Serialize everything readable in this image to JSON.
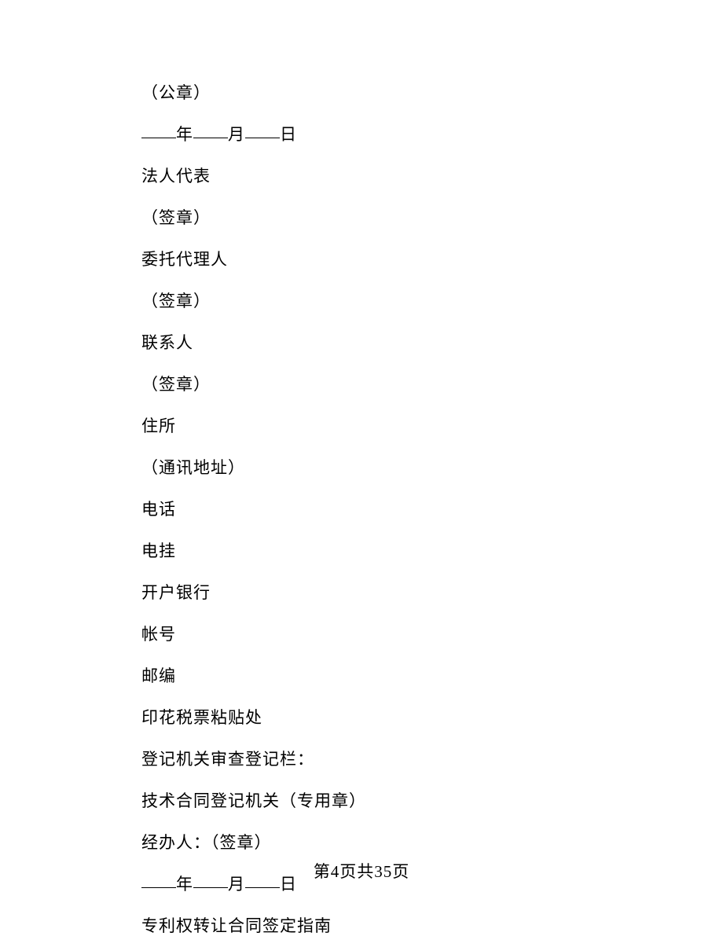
{
  "lines": [
    {
      "type": "text",
      "value": "（公章）"
    },
    {
      "type": "date",
      "parts": [
        "年",
        "月",
        "日"
      ]
    },
    {
      "type": "text",
      "value": "法人代表"
    },
    {
      "type": "text",
      "value": "（签章）"
    },
    {
      "type": "text",
      "value": "委托代理人"
    },
    {
      "type": "text",
      "value": "（签章）"
    },
    {
      "type": "text",
      "value": "联系人"
    },
    {
      "type": "text",
      "value": "（签章）"
    },
    {
      "type": "text",
      "value": "住所"
    },
    {
      "type": "text",
      "value": "（通讯地址）"
    },
    {
      "type": "text",
      "value": "电话"
    },
    {
      "type": "text",
      "value": "电挂"
    },
    {
      "type": "text",
      "value": "开户银行"
    },
    {
      "type": "text",
      "value": "帐号"
    },
    {
      "type": "text",
      "value": "邮编"
    },
    {
      "type": "text",
      "value": "印花税票粘贴处"
    },
    {
      "type": "text",
      "value": "登记机关审查登记栏："
    },
    {
      "type": "text",
      "value": "技术合同登记机关（专用章）"
    },
    {
      "type": "text",
      "value": "经办人：（签章）"
    },
    {
      "type": "date",
      "parts": [
        "年",
        "月",
        "日"
      ]
    },
    {
      "type": "text",
      "value": "专利权转让合同签定指南"
    }
  ],
  "footer": "第4页共35页"
}
